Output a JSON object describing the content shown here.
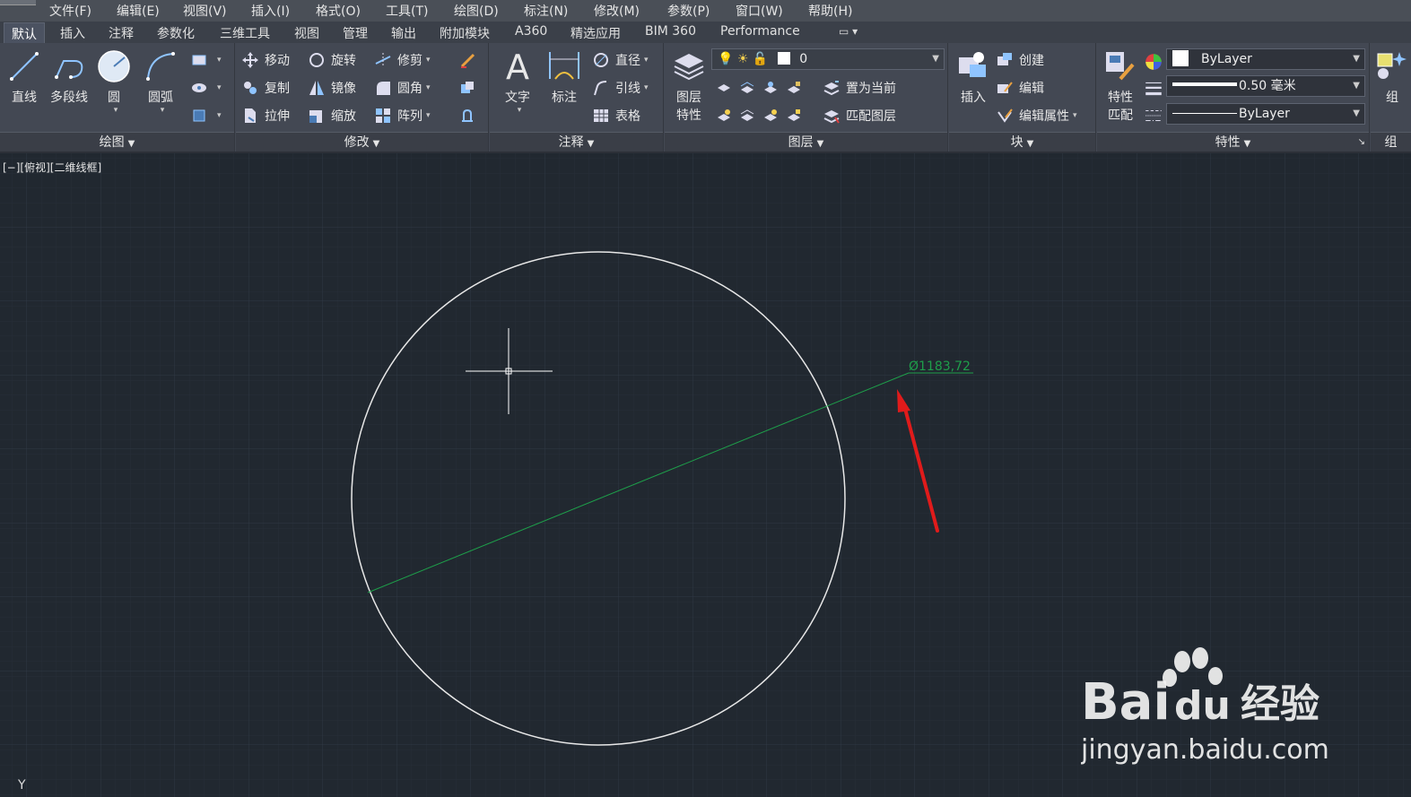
{
  "menu": [
    "文件(F)",
    "编辑(E)",
    "视图(V)",
    "插入(I)",
    "格式(O)",
    "工具(T)",
    "绘图(D)",
    "标注(N)",
    "修改(M)",
    "参数(P)",
    "窗口(W)",
    "帮助(H)"
  ],
  "tabs": [
    "默认",
    "插入",
    "注释",
    "参数化",
    "三维工具",
    "视图",
    "管理",
    "输出",
    "附加模块",
    "A360",
    "精选应用",
    "BIM 360",
    "Performance"
  ],
  "panels": {
    "draw": {
      "title": "绘图",
      "line": "直线",
      "polyline": "多段线",
      "circle": "圆",
      "arc": "圆弧"
    },
    "modify": {
      "title": "修改",
      "move": "移动",
      "rotate": "旋转",
      "trim": "修剪",
      "copy": "复制",
      "mirror": "镜像",
      "fillet": "圆角",
      "stretch": "拉伸",
      "scale": "缩放",
      "array": "阵列"
    },
    "annotation": {
      "title": "注释",
      "text": "文字",
      "dimension": "标注",
      "diameter": "直径",
      "leader": "引线",
      "table": "表格"
    },
    "layers": {
      "title": "图层",
      "properties_line1": "图层",
      "properties_line2": "特性",
      "current_layer": "0",
      "set_current": "置为当前",
      "match_layer": "匹配图层"
    },
    "block": {
      "title": "块",
      "insert": "插入",
      "create": "创建",
      "edit": "编辑",
      "edit_attributes": "编辑属性"
    },
    "properties": {
      "title": "特性",
      "match_line1": "特性",
      "match_line2": "匹配",
      "color": "ByLayer",
      "lineweight": "0.50 毫米",
      "linetype": "ByLayer"
    },
    "group": {
      "title": "组",
      "label": "组"
    }
  },
  "viewport": {
    "label": "[−][俯视][二维线框]",
    "ucs_y": "Y"
  },
  "drawing": {
    "dimension_text": "Ø1183,72",
    "circle_color": "#e8e8e8",
    "dimension_color": "#1e9e4a",
    "arrow_color": "#e01b1b"
  },
  "watermark": {
    "brand": "Bai",
    "brand2": "du",
    "cn": "经验",
    "url": "jingyan.baidu.com"
  }
}
